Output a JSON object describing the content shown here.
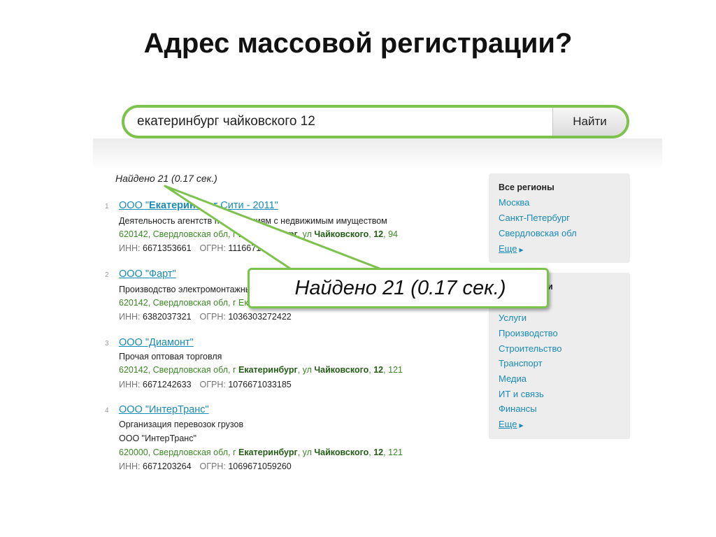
{
  "slide": {
    "title": "Адрес массовой регистрации?"
  },
  "search": {
    "query": "екатеринбург чайковского 12",
    "button_label": "Найти"
  },
  "found_text": "Найдено 21 (0.17 сек.)",
  "callout_text": "Найдено 21 (0.17 сек.)",
  "results": [
    {
      "num": "1",
      "title_prefix": "ООО \"",
      "title_bold": "Екатеринбург",
      "title_suffix": " Сити - 2011\"",
      "activity": "Деятельность агентств по операциям с недвижимым имуществом",
      "addr_prefix": "620142, Свердловская обл, г ",
      "addr_city": "Екатеринбург",
      "addr_mid": ", ул ",
      "addr_street": "Чайковского",
      "addr_sep": ", ",
      "addr_house": "12",
      "addr_suffix": ", 94",
      "inn_label": "ИНН:",
      "inn": "6671353661",
      "ogrn_label": "ОГРН:",
      "ogrn": "1116671..."
    },
    {
      "num": "2",
      "title": "ООО \"Фарт\"",
      "activity": "Производство электромонтажных работ",
      "addr": "620142, Свердловская обл, г Екатеринбург",
      "inn_label": "ИНН:",
      "inn": "6382037321",
      "ogrn_label": "ОГРН:",
      "ogrn": "1036303272422"
    },
    {
      "num": "3",
      "title": "ООО \"Диамонт\"",
      "activity": "Прочая оптовая торговля",
      "addr_prefix": "620142, Свердловская обл, г ",
      "addr_city": "Екатеринбург",
      "addr_mid": ", ул ",
      "addr_street": "Чайковского",
      "addr_sep": ", ",
      "addr_house": "12",
      "addr_suffix": ", 121",
      "inn_label": "ИНН:",
      "inn": "6671242633",
      "ogrn_label": "ОГРН:",
      "ogrn": "1076671033185"
    },
    {
      "num": "4",
      "title": "ООО \"ИнтерТранс\"",
      "activity": "Организация перевозок грузов",
      "extra": "ООО \"ИнтерТранс\"",
      "addr_prefix": "620000, Свердловская обл, г ",
      "addr_city": "Екатеринбург",
      "addr_mid": ", ул ",
      "addr_street": "Чайковского",
      "addr_sep": ", ",
      "addr_house": "12",
      "addr_suffix": ", 121",
      "inn_label": "ИНН:",
      "inn": "6671203264",
      "ogrn_label": "ОГРН:",
      "ogrn": "1069671059260"
    }
  ],
  "regions": {
    "heading": "Все регионы",
    "items": [
      "Москва",
      "Санкт-Петербург",
      "Свердловская обл"
    ],
    "more": "Еще"
  },
  "industries": {
    "heading_partial": "ли",
    "items": [
      "Услуги",
      "Производство",
      "Строительство",
      "Транспорт",
      "Медиа",
      "ИТ и связь",
      "Финансы"
    ],
    "more": "Еще"
  },
  "colors": {
    "accent_green": "#7ec24e",
    "link_blue": "#1a8ab7",
    "address_green": "#3b8a26"
  }
}
